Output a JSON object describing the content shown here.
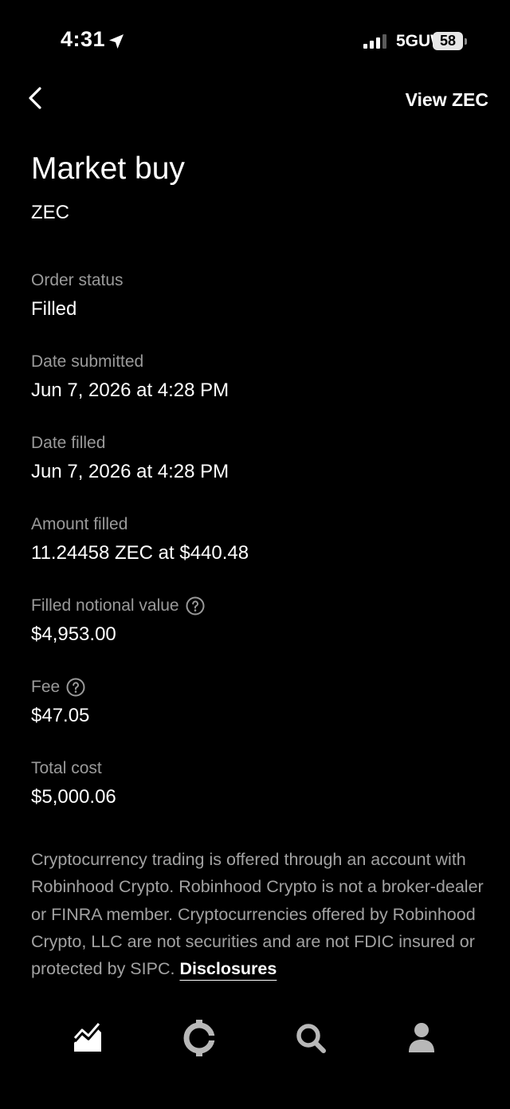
{
  "status_bar": {
    "time": "4:31",
    "network": "5GUW",
    "battery": "58"
  },
  "nav": {
    "back_icon": "chevron-left-icon",
    "view_link": "View ZEC"
  },
  "header": {
    "title": "Market buy",
    "subtitle": "ZEC"
  },
  "details": [
    {
      "label": "Order status",
      "value": "Filled",
      "has_help": false
    },
    {
      "label": "Date submitted",
      "value": "Jun 7, 2026 at 4:28 PM",
      "has_help": false
    },
    {
      "label": "Date filled",
      "value": "Jun 7, 2026 at 4:28 PM",
      "has_help": false
    },
    {
      "label": "Amount filled",
      "value": "11.24458 ZEC at $440.48",
      "has_help": false
    },
    {
      "label": "Filled notional value",
      "value": "$4,953.00",
      "has_help": true
    },
    {
      "label": "Fee",
      "value": "$47.05",
      "has_help": true
    },
    {
      "label": "Total cost",
      "value": "$5,000.06",
      "has_help": false
    }
  ],
  "disclaimer": {
    "text": "Cryptocurrency trading is offered through an account with Robinhood Crypto. Robinhood Crypto is not a broker-dealer or FINRA member. Cryptocurrencies offered by Robinhood Crypto, LLC are not securities and are not FDIC insured or protected by SIPC. ",
    "link_label": "Disclosures"
  },
  "tab_bar": {
    "tabs": [
      {
        "icon": "investing-chart-icon"
      },
      {
        "icon": "crypto-coin-icon"
      },
      {
        "icon": "search-icon"
      },
      {
        "icon": "account-person-icon"
      }
    ]
  },
  "colors": {
    "background": "#000000",
    "text_primary": "#ffffff",
    "text_secondary": "#9a9a9a",
    "tab_icon": "#d9d9d9"
  }
}
